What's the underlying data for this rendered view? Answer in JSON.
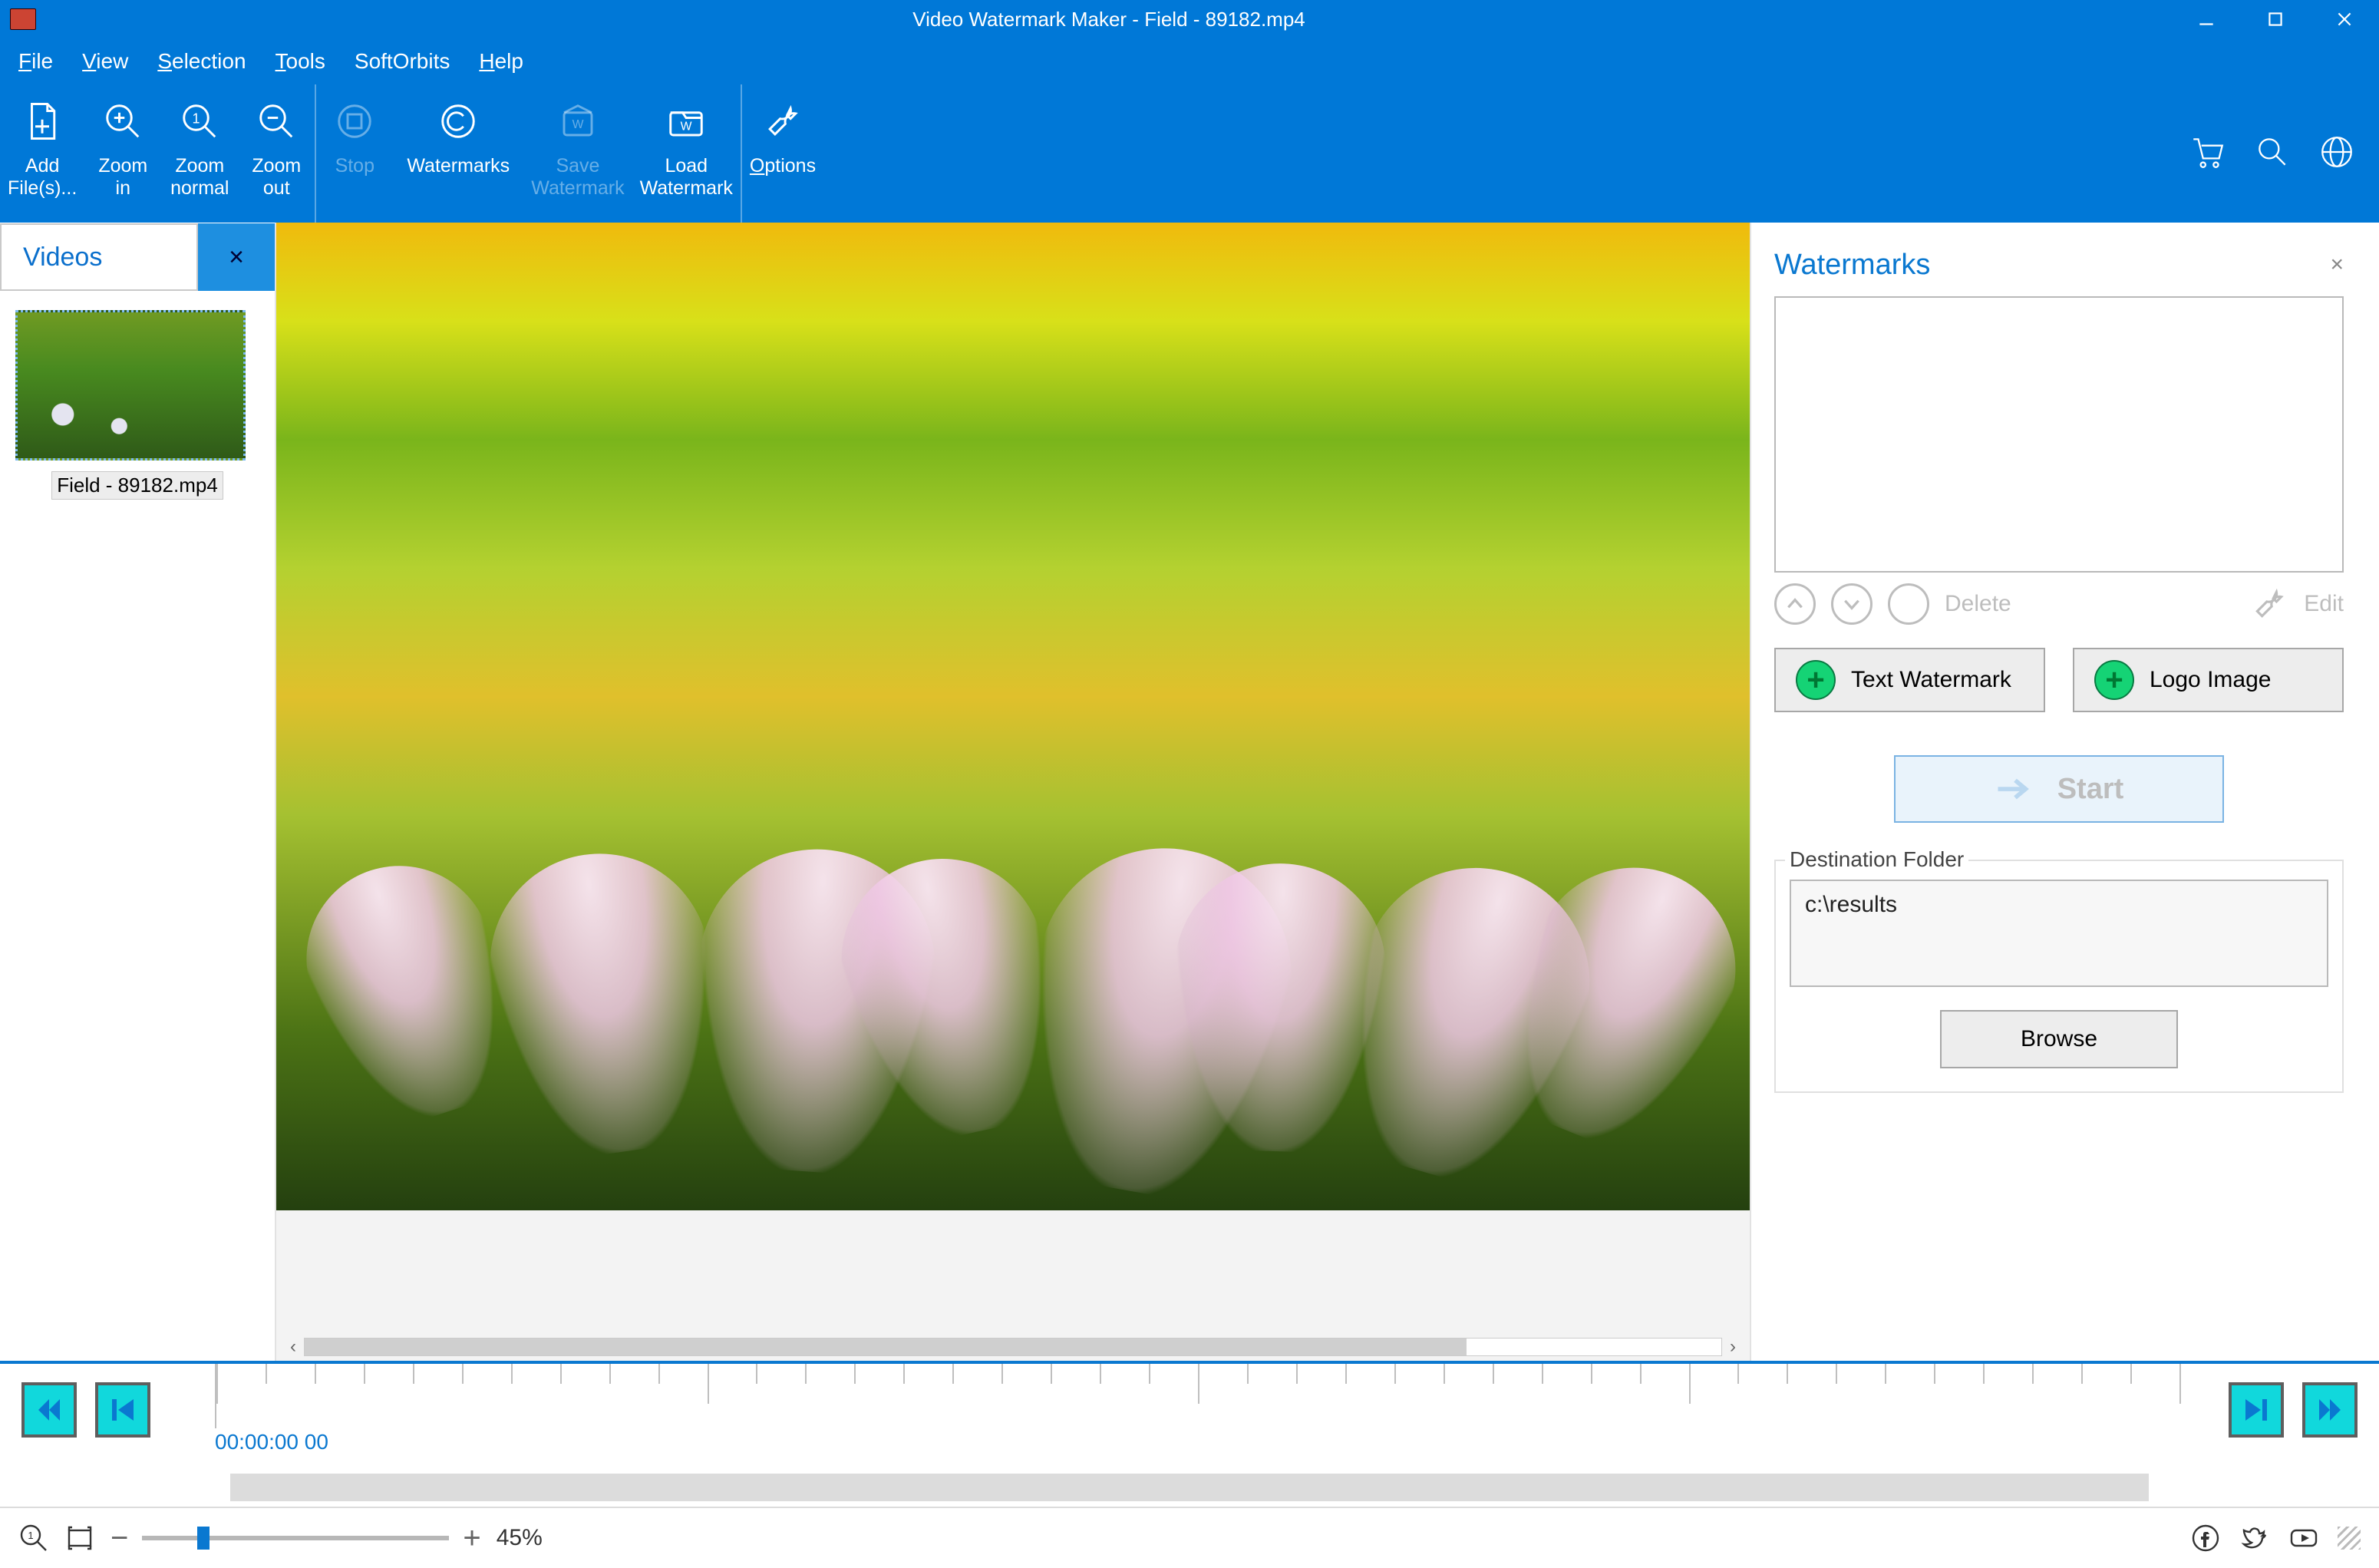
{
  "window": {
    "title": "Video Watermark Maker - Field - 89182.mp4"
  },
  "menu": {
    "file": "File",
    "view": "View",
    "selection": "Selection",
    "tools": "Tools",
    "softorbits": "SoftOrbits",
    "help": "Help"
  },
  "ribbon": {
    "add_files": "Add\nFile(s)...",
    "zoom_in": "Zoom\nin",
    "zoom_normal": "Zoom\nnormal",
    "zoom_out": "Zoom\nout",
    "stop": "Stop",
    "watermarks": "Watermarks",
    "save_watermark": "Save\nWatermark",
    "load_watermark": "Load\nWatermark",
    "options": "Options"
  },
  "sidebar": {
    "tab_label": "Videos",
    "items": [
      {
        "caption": "Field - 89182.mp4"
      }
    ]
  },
  "right": {
    "title": "Watermarks",
    "delete": "Delete",
    "edit": "Edit",
    "text_watermark": "Text Watermark",
    "logo_image": "Logo Image",
    "start": "Start",
    "dest_legend": "Destination Folder",
    "dest_value": "c:\\results",
    "browse": "Browse"
  },
  "timeline": {
    "timecode": "00:00:00 00"
  },
  "status": {
    "zoom_label": "45%"
  }
}
